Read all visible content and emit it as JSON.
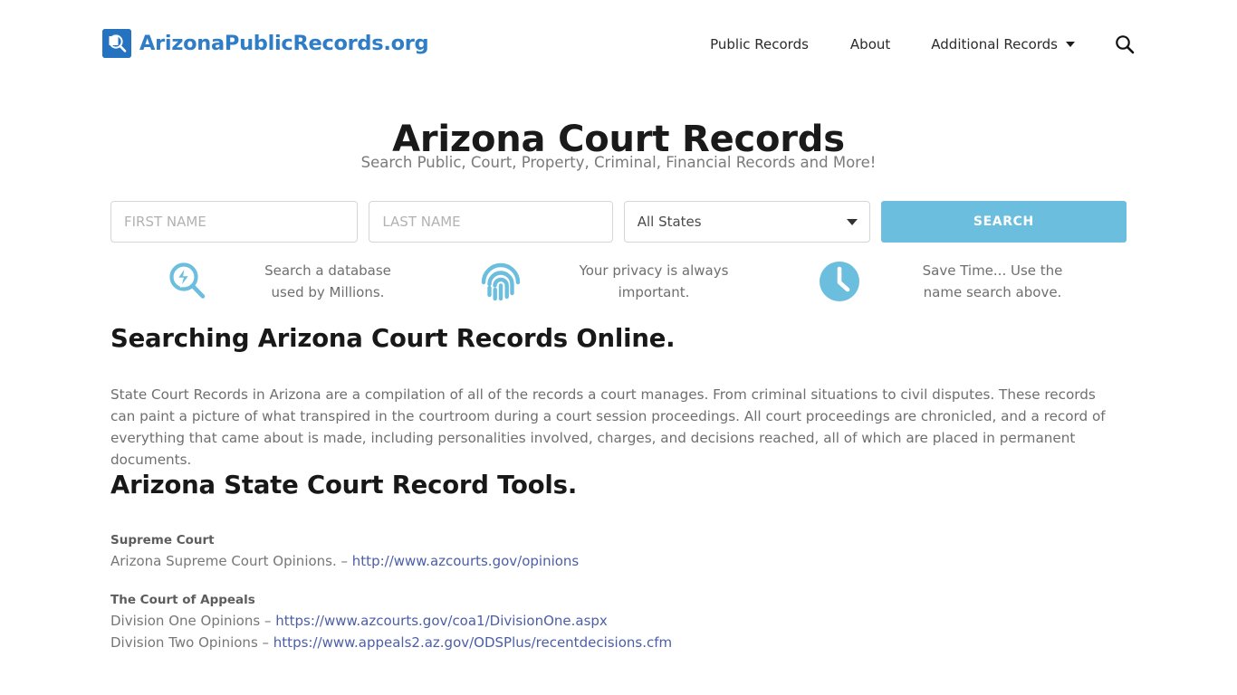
{
  "header": {
    "brand_name": "ArizonaPublicRecords.org",
    "brand_icon": "magnifier-document-icon",
    "nav": [
      {
        "label": "Public Records"
      },
      {
        "label": "About"
      },
      {
        "label": "Additional Records",
        "has_dropdown": true
      }
    ],
    "search_icon": "search-icon"
  },
  "hero": {
    "title": "Arizona Court Records",
    "subtitle": "Search Public, Court, Property, Criminal, Financial Records and More!"
  },
  "search_form": {
    "first_name_placeholder": "FIRST NAME",
    "first_name_value": "",
    "last_name_placeholder": "LAST NAME",
    "last_name_value": "",
    "state_selected": "All States",
    "submit_label": "SEARCH",
    "accent_color": "#6cbede"
  },
  "features": [
    {
      "icon": "magnifier-bolt-icon",
      "line1": "Search a database",
      "line2": "used by Millions."
    },
    {
      "icon": "fingerprint-icon",
      "line1": "Your privacy is always",
      "line2": "important."
    },
    {
      "icon": "clock-icon",
      "line1": "Save Time... Use the",
      "line2": "name search above."
    }
  ],
  "sections": {
    "searching_title": "Searching Arizona Court Records Online.",
    "searching_paragraph": "State Court Records in Arizona are a compilation of all of the records a court manages. From criminal situations to civil disputes. These records can paint a picture of what transpired in the courtroom during a court session proceedings. All court proceedings are chronicled, and a record of everything that came about is made, including personalities involved, charges, and decisions reached, all of which are placed in permanent documents.",
    "tools_title": "Arizona State Court Record Tools."
  },
  "tools": [
    {
      "heading": "Supreme Court",
      "lines": [
        {
          "prefix": "Arizona Supreme Court Opinions. – ",
          "link": "http://www.azcourts.gov/opinions"
        }
      ]
    },
    {
      "heading": "The Court of Appeals",
      "lines": [
        {
          "prefix": "Division One Opinions – ",
          "link": "https://www.azcourts.gov/coa1/DivisionOne.aspx"
        },
        {
          "prefix": "Division Two Opinions – ",
          "link": "https://www.appeals2.az.gov/ODSPlus/recentdecisions.cfm"
        }
      ]
    }
  ]
}
